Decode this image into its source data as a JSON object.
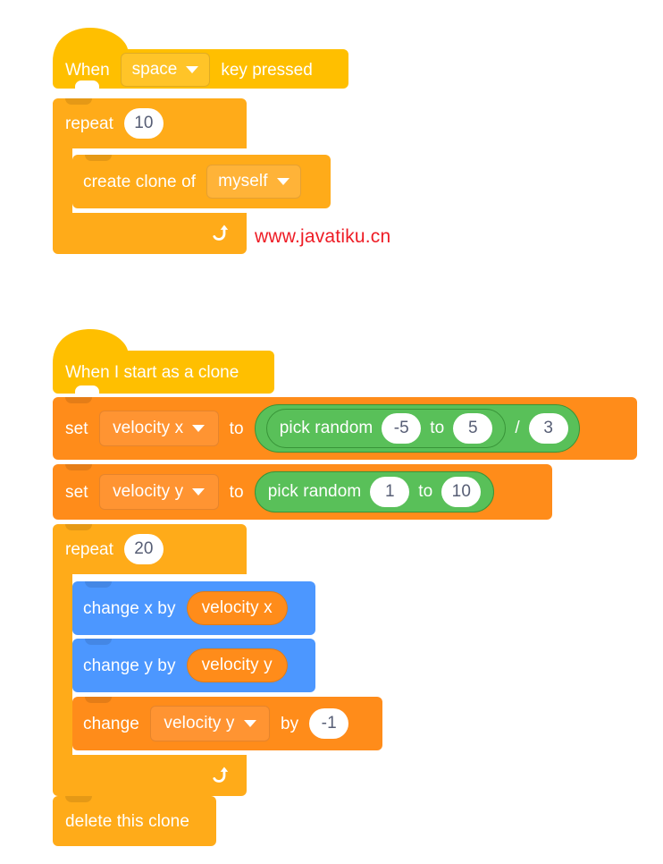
{
  "meta": {
    "app": "Scratch block editor",
    "background_color": "#FFFFFF"
  },
  "palette": {
    "event_yellow": "#FFBF00",
    "control_orange": "#FFAB19",
    "variable_orange": "#FF8C1A",
    "motion_blue": "#4C97FF",
    "operator_green": "#59C059",
    "input_white": "#FFFFFF",
    "input_text": "#575E75",
    "watermark_red": "#EE1C25"
  },
  "watermark": {
    "text": "www.javatiku.cn"
  },
  "script1": {
    "name": "when-space-key-pressed-script",
    "hat": {
      "prefix": "When",
      "dropdown_value": "space",
      "suffix": "key pressed",
      "dropdown_icon": "chevron-down-icon"
    },
    "repeat": {
      "label": "repeat",
      "times": "10",
      "loop_icon": "loop-arrow-icon"
    },
    "create_clone": {
      "label": "create clone of",
      "dropdown_value": "myself",
      "dropdown_icon": "chevron-down-icon"
    }
  },
  "script2": {
    "name": "when-i-start-as-a-clone-script",
    "hat": {
      "label": "When I start as a clone"
    },
    "set_velocity_x": {
      "keyword": "set",
      "variable": "velocity x",
      "to": "to",
      "dropdown_icon": "chevron-down-icon",
      "value": {
        "operator": "/",
        "left": {
          "label": "pick random",
          "from": "-5",
          "to_label": "to",
          "to": "5"
        },
        "right": "3"
      }
    },
    "set_velocity_y": {
      "keyword": "set",
      "variable": "velocity y",
      "to": "to",
      "dropdown_icon": "chevron-down-icon",
      "value": {
        "label": "pick random",
        "from": "1",
        "to_label": "to",
        "to": "10"
      }
    },
    "repeat": {
      "label": "repeat",
      "times": "20",
      "loop_icon": "loop-arrow-icon"
    },
    "change_x": {
      "label": "change x by",
      "reporter": "velocity x"
    },
    "change_y": {
      "label": "change y by",
      "reporter": "velocity y"
    },
    "change_velocity_y": {
      "keyword": "change",
      "variable": "velocity y",
      "by_label": "by",
      "dropdown_icon": "chevron-down-icon",
      "value": "-1"
    },
    "delete_clone": {
      "label": "delete this clone"
    }
  }
}
